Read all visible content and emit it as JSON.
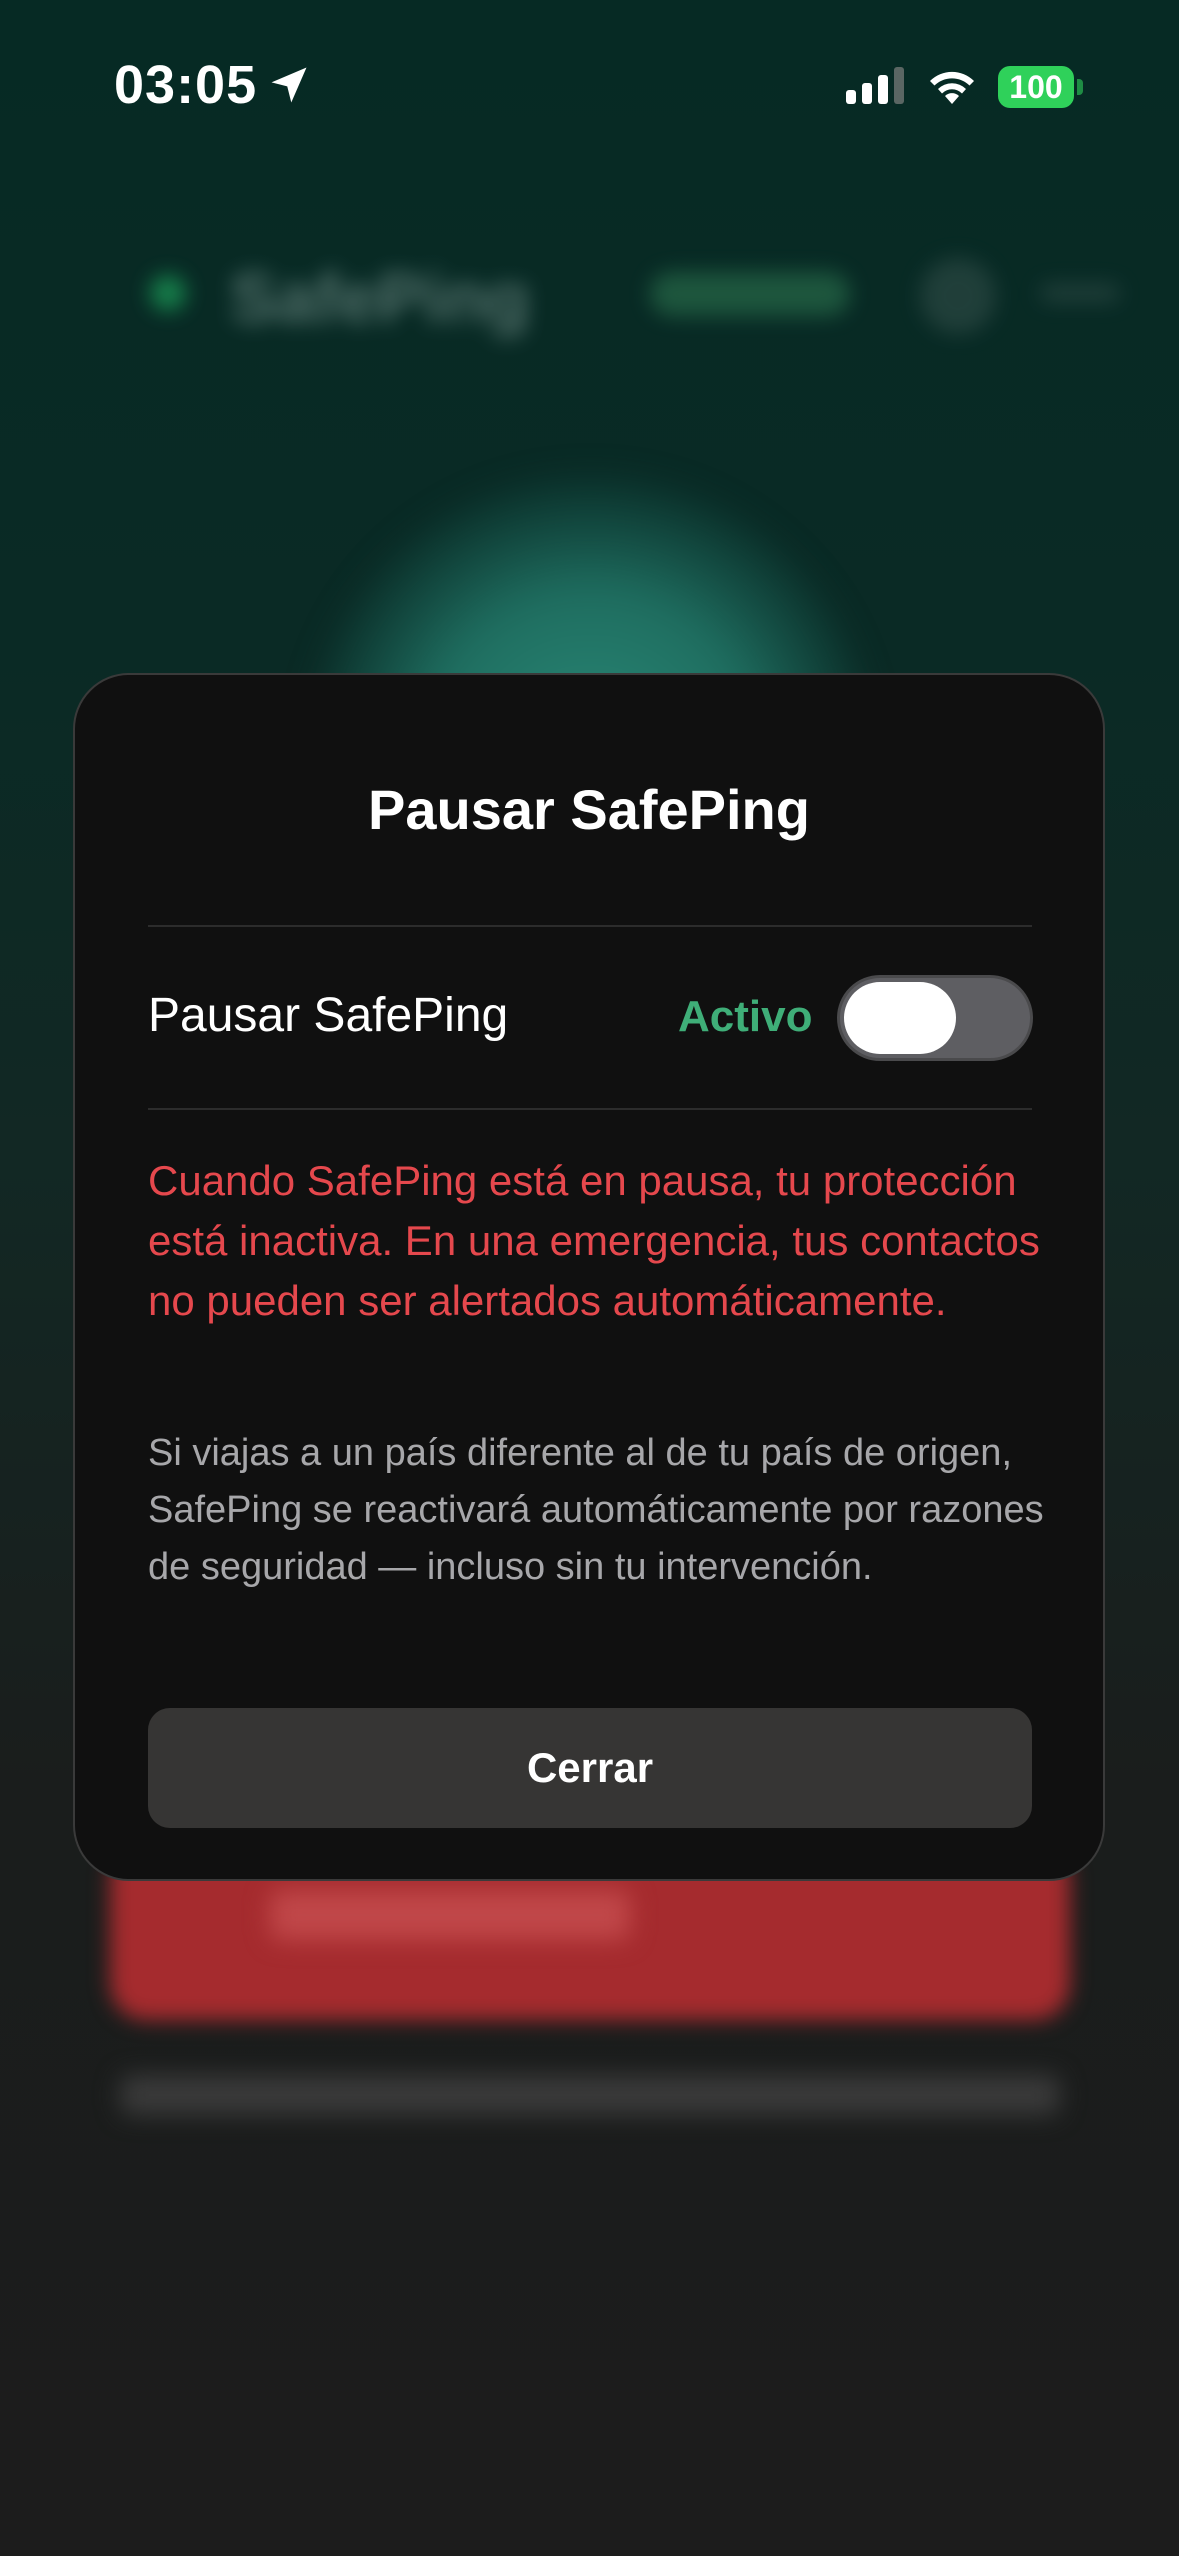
{
  "status_bar": {
    "time": "03:05",
    "battery": "100"
  },
  "background_app": {
    "app_name": "SafePing"
  },
  "modal": {
    "title": "Pausar SafePing",
    "toggle_row": {
      "label": "Pausar SafePing",
      "status": "Activo",
      "toggle_on": false
    },
    "warning": "Cuando SafePing está en pausa, tu protección está inactiva. En una emergencia, tus contactos no pueden ser alertados automáticamente.",
    "info": "Si viajas a un país diferente al de tu país de origen, SafePing se reactivará automáticamente por razones de seguridad — incluso sin tu intervención.",
    "close_label": "Cerrar"
  },
  "colors": {
    "modal_background": "#101010",
    "status_active": "#3fae78",
    "warning": "#e5484d",
    "battery": "#2fd15a"
  }
}
